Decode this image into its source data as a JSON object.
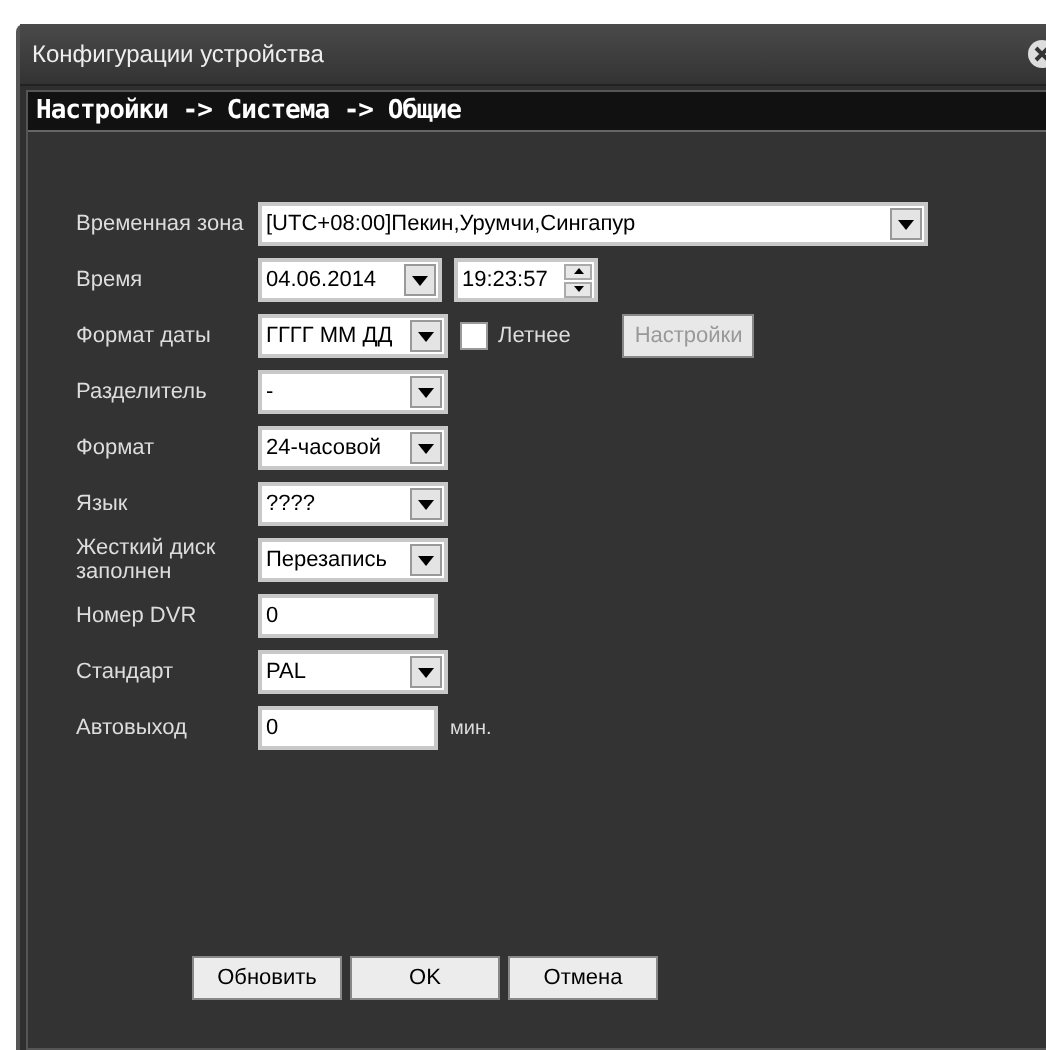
{
  "window": {
    "title": "Конфигурации устройства"
  },
  "header": "Настройки -> Система -> Общие",
  "rows": [
    {
      "label": "Временная зона",
      "controls": [
        {
          "kind": "zone-select",
          "value": "[UTC+08:00]Пекин,Урумчи,Сингапур"
        }
      ]
    },
    {
      "label": "Время",
      "controls": [
        {
          "kind": "date-select",
          "value": "04.06.2014"
        },
        {
          "kind": "spin",
          "value": "19:23:57"
        }
      ]
    },
    {
      "label": "Формат даты",
      "controls": [
        {
          "kind": "select",
          "value": "ГГГГ ММ ДД"
        },
        {
          "kind": "checkbox",
          "label": "Летнее",
          "checked": false
        },
        {
          "kind": "button",
          "label": "Настройки",
          "disabled": true
        }
      ]
    },
    {
      "label": "Разделитель",
      "controls": [
        {
          "kind": "select",
          "value": "-"
        }
      ]
    },
    {
      "label": "Формат",
      "controls": [
        {
          "kind": "select",
          "value": "24-часовой"
        }
      ]
    },
    {
      "label": "Язык",
      "controls": [
        {
          "kind": "select",
          "value": "????"
        }
      ]
    },
    {
      "label": "Жесткий диск заполнен",
      "controls": [
        {
          "kind": "select",
          "value": "Перезапись"
        }
      ]
    },
    {
      "label": "Номер DVR",
      "controls": [
        {
          "kind": "text",
          "value": "0"
        }
      ]
    },
    {
      "label": "Стандарт",
      "controls": [
        {
          "kind": "select",
          "value": "PAL"
        }
      ]
    },
    {
      "label": "Автовыход",
      "controls": [
        {
          "kind": "text",
          "value": "0"
        },
        {
          "kind": "unit",
          "text": "мин."
        }
      ]
    }
  ],
  "buttons": [
    "Обновить",
    "OK",
    "Отмена"
  ]
}
